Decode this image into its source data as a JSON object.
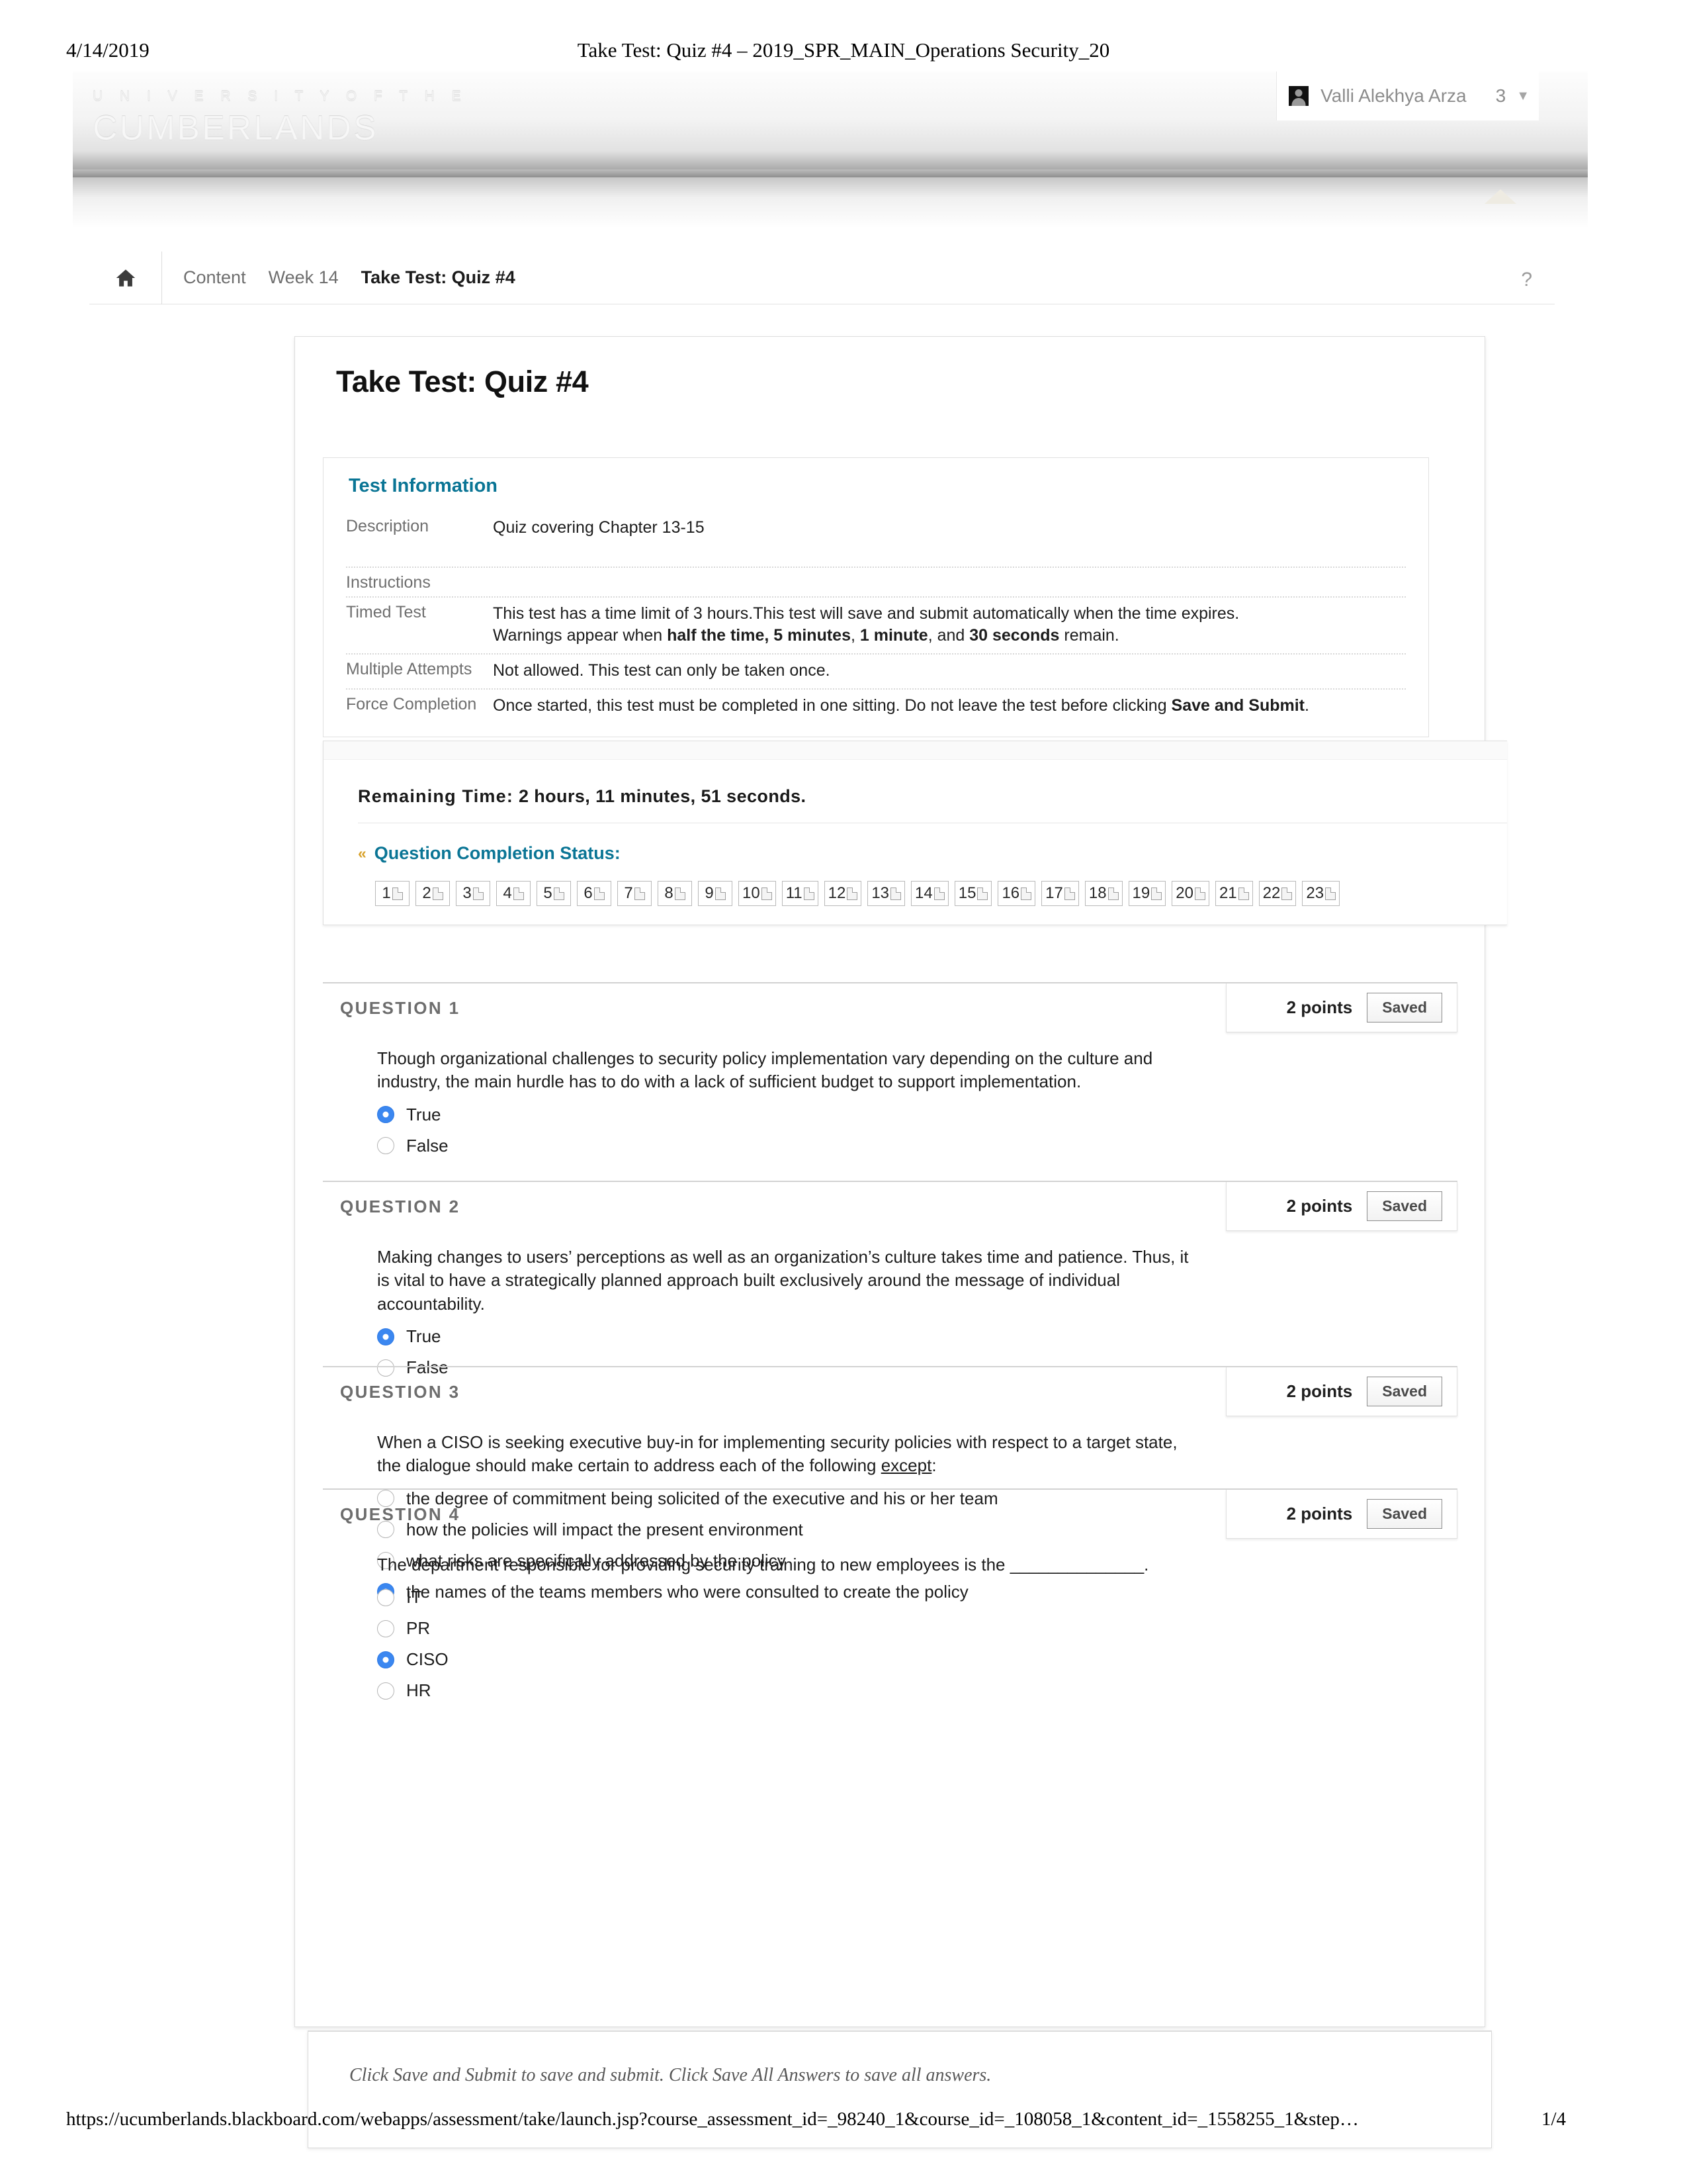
{
  "print": {
    "date": "4/14/2019",
    "title": "Take Test: Quiz #4 – 2019_SPR_MAIN_Operations Security_20",
    "url": "https://ucumberlands.blackboard.com/webapps/assessment/take/launch.jsp?course_assessment_id=_98240_1&course_id=_108058_1&content_id=_1558255_1&step…",
    "page": "1/4"
  },
  "masthead": {
    "brand_line1": "U N I V E R S I T Y   O F   T H E",
    "brand_line2": "CUMBERLANDS",
    "user_name": "Valli Alekhya Arza",
    "notification_count": "3",
    "caret": "▼"
  },
  "breadcrumb": {
    "home_icon": "home-icon",
    "items": [
      {
        "label": "Content",
        "active": false
      },
      {
        "label": "Week 14",
        "active": false
      },
      {
        "label": "Take Test: Quiz #4",
        "active": true
      }
    ],
    "help": "?"
  },
  "page_title": "Take Test: Quiz #4",
  "test_information": {
    "heading": "Test Information",
    "rows": [
      {
        "label": "Description",
        "value": "Quiz covering Chapter 13-15"
      },
      {
        "label": "Instructions",
        "value": ""
      },
      {
        "label": "Timed Test",
        "value": ""
      },
      {
        "label": "Multiple Attempts",
        "value": "Not allowed. This test can only be taken once."
      },
      {
        "label": "Force Completion",
        "value": ""
      }
    ],
    "timed_test_line1": "This test has a time limit of 3 hours.This test will save and submit automatically when the time expires.",
    "timed_test_line2_pre": "Warnings appear when ",
    "timed_test_b1": "half the time",
    "timed_test_sep1": ", ",
    "timed_test_b2": "5 minutes",
    "timed_test_sep2": ", ",
    "timed_test_b3": "1 minute",
    "timed_test_sep3": ", and ",
    "timed_test_b4": "30 seconds",
    "timed_test_end": " remain.",
    "force_completion_pre": "Once started, this test must be completed in one sitting. Do not leave the test before clicking ",
    "force_completion_bold": "Save and Submit",
    "force_completion_end": "."
  },
  "timer": {
    "remaining_label": "Remaining Time:",
    "remaining_value": "2 hours, 11 minutes, 51 seconds.",
    "status_label": "Question Completion Status:",
    "chevron": "«",
    "tiles": [
      "1",
      "2",
      "3",
      "4",
      "5",
      "6",
      "7",
      "8",
      "9",
      "10",
      "11",
      "12",
      "13",
      "14",
      "15",
      "16",
      "17",
      "18",
      "19",
      "20",
      "21",
      "22",
      "23"
    ]
  },
  "questions": [
    {
      "number": "QUESTION 1",
      "points": "2 points",
      "saved": "Saved",
      "text": "Though organizational challenges to security policy implementation vary depending on the culture and industry, the main hurdle has to do with a lack of sufficient budget to support implementation.",
      "options": [
        {
          "label": "True",
          "selected": true
        },
        {
          "label": "False",
          "selected": false
        }
      ]
    },
    {
      "number": "QUESTION 2",
      "points": "2 points",
      "saved": "Saved",
      "text": "Making changes to users’ perceptions as well as an organization’s culture takes time and patience. Thus, it is vital to have a strategically planned approach built exclusively around the message of individual accountability.",
      "options": [
        {
          "label": "True",
          "selected": true
        },
        {
          "label": "False",
          "selected": false
        }
      ]
    },
    {
      "number": "QUESTION 3",
      "points": "2 points",
      "saved": "Saved",
      "text_pre": "When a CISO is seeking executive buy-in for implementing security policies with respect to a target state, the dialogue should make certain to address each of the following ",
      "text_underline": "except",
      "text_post": ":",
      "options": [
        {
          "label": "the degree of commitment being solicited of the executive and his or her team",
          "selected": false
        },
        {
          "label": "how the policies will impact the present environment",
          "selected": false
        },
        {
          "label": "what risks are specifically addressed by the policy",
          "selected": false
        },
        {
          "label": "the names of the teams members who were consulted to create the policy",
          "selected": true
        }
      ]
    },
    {
      "number": "QUESTION 4",
      "points": "2 points",
      "saved": "Saved",
      "text": "The department responsible for providing security training to new employees is the ______________.",
      "options": [
        {
          "label": "IT",
          "selected": false
        },
        {
          "label": "PR",
          "selected": false
        },
        {
          "label": "CISO",
          "selected": true
        },
        {
          "label": "HR",
          "selected": false
        }
      ]
    }
  ],
  "save_bar": {
    "note": "Click Save and Submit to save and submit. Click Save All Answers to save all answers."
  },
  "colors": {
    "link_teal": "#0a7595",
    "radio_blue": "#3b87f0",
    "chevron_gold": "#d8a12a"
  }
}
